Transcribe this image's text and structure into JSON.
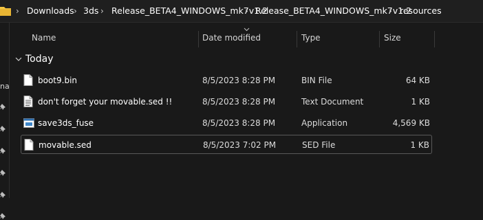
{
  "address_bar": {
    "crumbs": [
      "Downloads",
      "3ds",
      "Release_BETA4_WINDOWS_mk7v1.2",
      "Release_BETA4_WINDOWS_mk7v1.2",
      "resources"
    ]
  },
  "nav_pane": {
    "fragment": "na"
  },
  "columns": {
    "name": "Name",
    "date": "Date modified",
    "type": "Type",
    "size": "Size"
  },
  "group": {
    "label": "Today"
  },
  "files": [
    {
      "name": "boot9.bin",
      "date": "8/5/2023 8:28 PM",
      "type": "BIN File",
      "size": "64 KB",
      "icon": "file-icon"
    },
    {
      "name": "don't forget your movable.sed !!",
      "date": "8/5/2023 8:28 PM",
      "type": "Text Document",
      "size": "1 KB",
      "icon": "text-document-icon"
    },
    {
      "name": "save3ds_fuse",
      "date": "8/5/2023 8:28 PM",
      "type": "Application",
      "size": "4,569 KB",
      "icon": "application-icon"
    },
    {
      "name": "movable.sed",
      "date": "8/5/2023 7:02 PM",
      "type": "SED File",
      "size": "1 KB",
      "icon": "file-icon",
      "selected": true
    }
  ],
  "colors": {
    "background": "#191919",
    "selection_border": "#5a5a5a",
    "folder": "#f4c542"
  }
}
